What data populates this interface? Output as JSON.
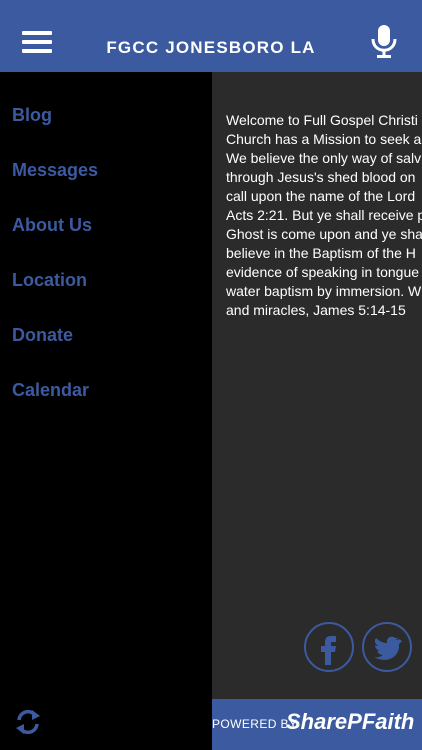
{
  "header": {
    "title": "FGCC JONESBORO LA"
  },
  "sidebar": {
    "items": [
      {
        "label": "Blog"
      },
      {
        "label": "Messages"
      },
      {
        "label": "About Us"
      },
      {
        "label": "Location"
      },
      {
        "label": "Donate"
      },
      {
        "label": "Calendar"
      }
    ]
  },
  "content": {
    "text": "Welcome to Full Gospel Christi\nChurch has a Mission to seek a\nWe believe the only way of salv\nthrough Jesus's shed blood on \ncall upon the name of the Lord\nActs 2:21. But ye shall receive p\nGhost is come upon and ye sha\nbelieve in the Baptism of the H\nevidence of speaking in tongue\nwater baptism by immersion. W\nand miracles, James 5:14-15"
  },
  "footer": {
    "powered_by": "POWERED BY",
    "brand": "SharePFaith"
  },
  "colors": {
    "brand_blue": "#3c5aa0",
    "content_bg": "#2b2b2b",
    "sidebar_bg": "#000000"
  },
  "icons": {
    "menu": "hamburger-icon",
    "mic": "microphone-icon",
    "refresh": "refresh-icon",
    "facebook": "facebook-icon",
    "twitter": "twitter-icon"
  }
}
